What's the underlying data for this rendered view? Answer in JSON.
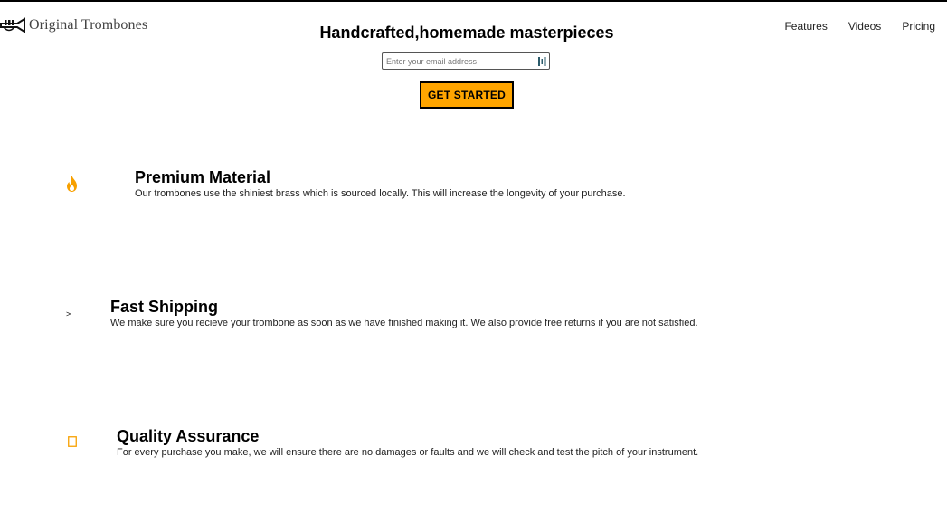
{
  "header": {
    "logo_icon": "trumpet-icon",
    "logo_text": "Original Trombones",
    "nav": [
      {
        "label": "Features"
      },
      {
        "label": "Videos"
      },
      {
        "label": "Pricing"
      }
    ]
  },
  "hero": {
    "title": "Handcrafted,homemade masterpieces",
    "email_placeholder": "Enter your email address",
    "email_value": "",
    "cta_label": "GET STARTED"
  },
  "features": [
    {
      "icon": "fire-icon",
      "title": "Premium Material",
      "description": "Our trombones use the shiniest brass which is sourced locally. This will increase the longevity of your purchase."
    },
    {
      "icon": "arrow-icon",
      "icon_glyph": ">",
      "title": "Fast Shipping",
      "description": "We make sure you recieve your trombone as soon as we have finished making it. We also provide free returns if you are not satisfied."
    },
    {
      "icon": "quality-box-icon",
      "title": "Quality Assurance",
      "description": "For every purchase you make, we will ensure there are no damages or faults and we will check and test the pitch of your instrument."
    }
  ],
  "colors": {
    "accent": "#ffa500",
    "text": "#000000",
    "border": "#000000"
  }
}
